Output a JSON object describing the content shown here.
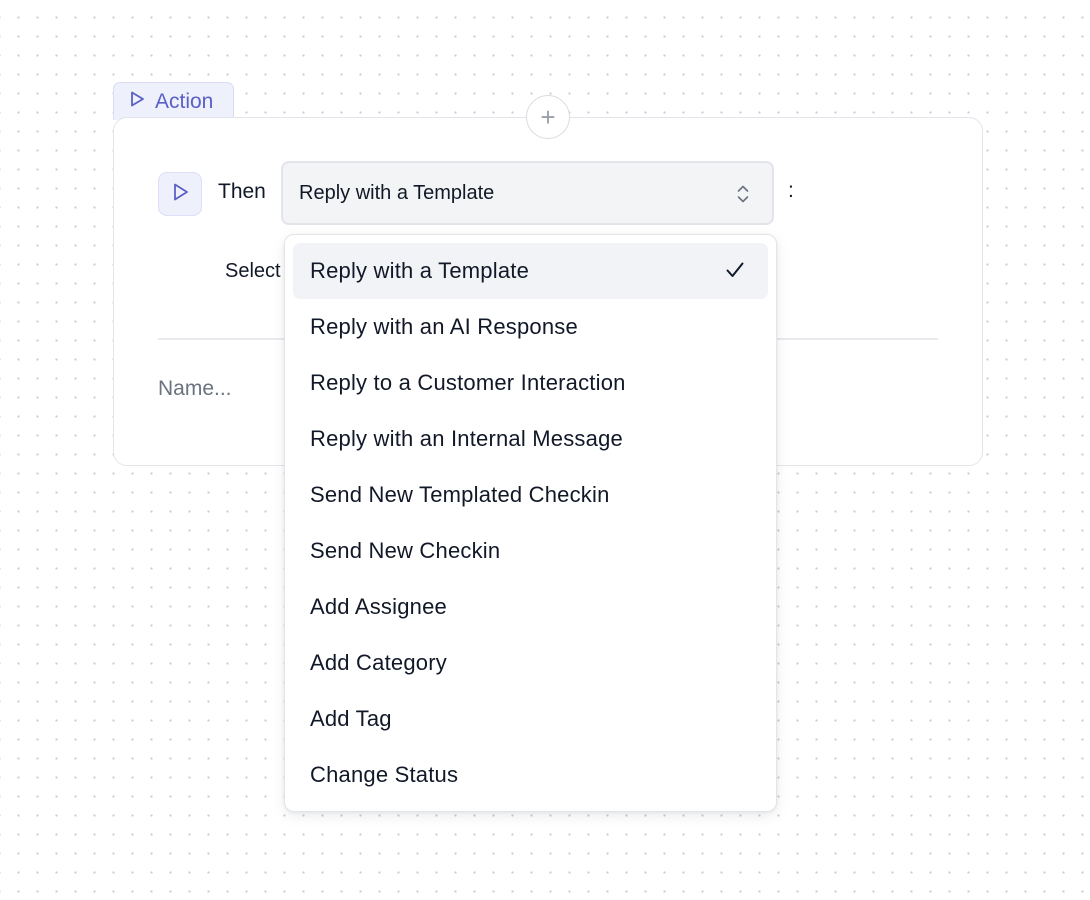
{
  "action_tab": {
    "label": "Action"
  },
  "add_button": {
    "label": "+"
  },
  "row": {
    "then_label": "Then",
    "selected_value": "Reply with a Template",
    "colon": ":"
  },
  "select_label": "Select",
  "name_field": {
    "placeholder": "Name..."
  },
  "menu": {
    "items": [
      {
        "label": "Reply with a Template",
        "selected": true
      },
      {
        "label": "Reply with an AI Response"
      },
      {
        "label": "Reply to a Customer Interaction"
      },
      {
        "label": "Reply with an Internal Message"
      },
      {
        "label": "Send New Templated Checkin"
      },
      {
        "label": "Send New Checkin"
      },
      {
        "label": "Add Assignee"
      },
      {
        "label": "Add Category"
      },
      {
        "label": "Add Tag"
      },
      {
        "label": "Change Status"
      }
    ]
  },
  "colors": {
    "accent": "#5a60c4",
    "accent_bg": "#eef0fb",
    "selected_bg": "#f1f3f7",
    "canvas_dot": "#c9ccd3"
  }
}
